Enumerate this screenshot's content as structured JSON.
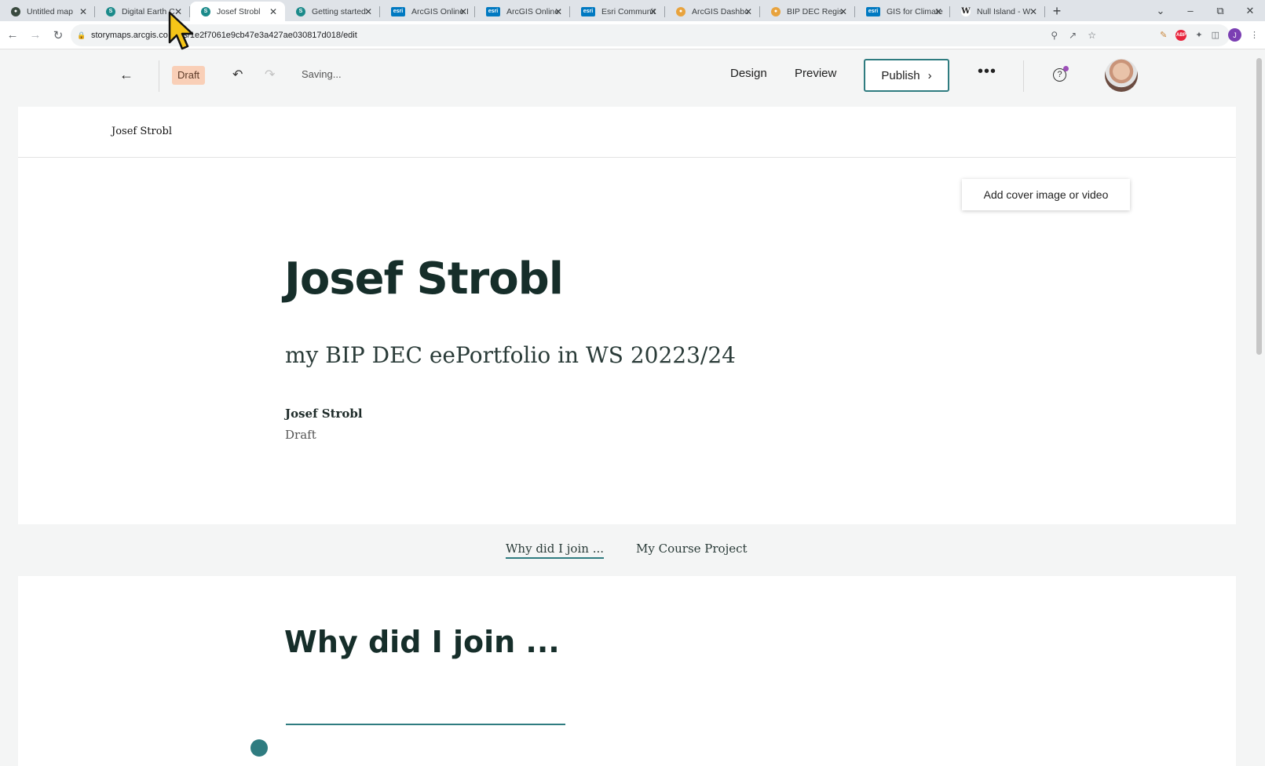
{
  "browser": {
    "tabs": [
      {
        "title": "Untitled map",
        "favicon": "globe-icon",
        "color": "#3a4a3f",
        "active": false
      },
      {
        "title": "Digital Earth C",
        "favicon": "storymaps-icon",
        "color": "#1b8a8a",
        "active": false
      },
      {
        "title": "Josef Strobl",
        "favicon": "storymaps-icon",
        "color": "#1b8a8a",
        "active": true
      },
      {
        "title": "Getting started",
        "favicon": "storymaps-icon",
        "color": "#1b8a8a",
        "active": false
      },
      {
        "title": "ArcGIS Online I",
        "favicon": "esri-icon",
        "color": "#0079c1",
        "active": false
      },
      {
        "title": "ArcGIS Online:",
        "favicon": "esri-icon",
        "color": "#0079c1",
        "active": false
      },
      {
        "title": "Esri Communit",
        "favicon": "esri-icon",
        "color": "#0079c1",
        "active": false
      },
      {
        "title": "ArcGIS Dashbo",
        "favicon": "dashboard-icon",
        "color": "#e8a33d",
        "active": false
      },
      {
        "title": "BIP DEC Regist",
        "favicon": "dashboard-icon",
        "color": "#e8a33d",
        "active": false
      },
      {
        "title": "GIS for Climate",
        "favicon": "esri-icon",
        "color": "#0079c1",
        "active": false
      },
      {
        "title": "Null Island - W",
        "favicon": "wikipedia-icon",
        "color": "#222222",
        "active": false
      }
    ],
    "url": "storymaps.arcgis.co…ies/1e2f7061e9cb47e3a427ae030817d018/edit"
  },
  "builder": {
    "draft_badge": "Draft",
    "saving_status": "Saving...",
    "design_label": "Design",
    "preview_label": "Preview",
    "publish_label": "Publish",
    "more_label": "•••"
  },
  "story": {
    "header_title": "Josef Strobl",
    "cover_button": "Add cover image or video",
    "title": "Josef Strobl",
    "subtitle": "my BIP DEC eePortfolio in WS 20223/24",
    "byline": "Josef Strobl",
    "status": "Draft",
    "nav": [
      "Why did I join ...",
      "My Course Project"
    ],
    "section_heading": "Why did I join ..."
  },
  "colors": {
    "accent": "#2f7c80",
    "draft_badge_bg": "#f9cfb7",
    "title_text": "#162e2a"
  }
}
